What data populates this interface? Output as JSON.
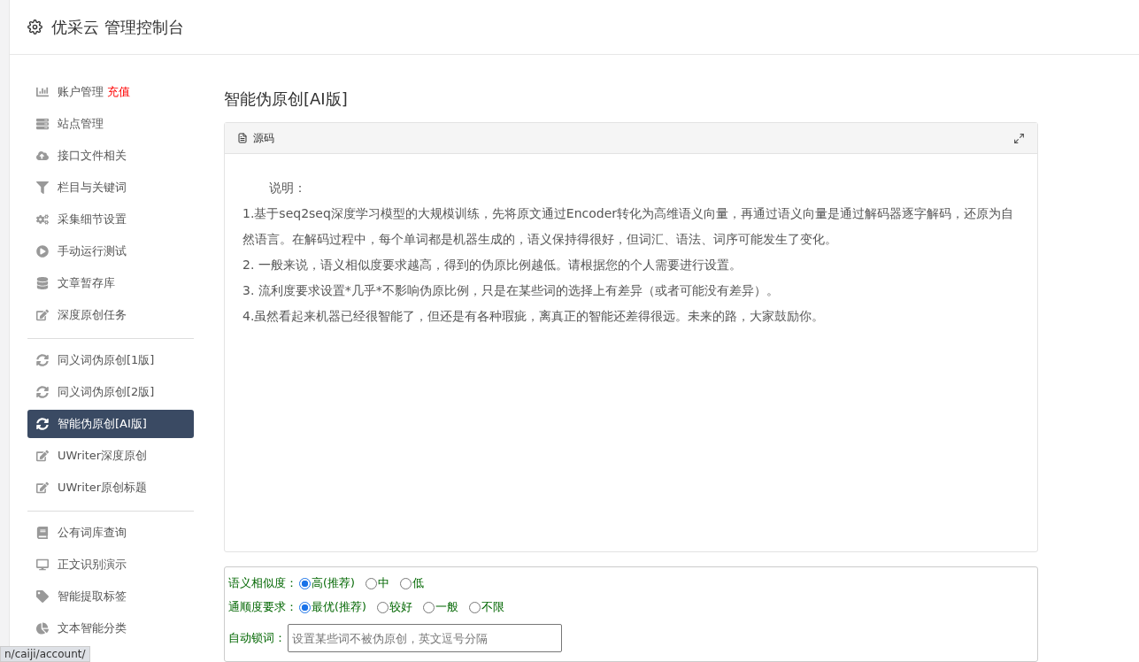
{
  "header": {
    "title": "优采云 管理控制台"
  },
  "sidebar": {
    "groups": [
      {
        "items": [
          {
            "label": "账户管理",
            "badge": "充值",
            "selected": false
          },
          {
            "label": "站点管理",
            "selected": false
          },
          {
            "label": "接口文件相关",
            "selected": false
          },
          {
            "label": "栏目与关键词",
            "selected": false
          },
          {
            "label": "采集细节设置",
            "selected": false
          },
          {
            "label": "手动运行测试",
            "selected": false
          },
          {
            "label": "文章暂存库",
            "selected": false
          },
          {
            "label": "深度原创任务",
            "selected": false
          }
        ]
      },
      {
        "items": [
          {
            "label": "同义词伪原创[1版]",
            "selected": false
          },
          {
            "label": "同义词伪原创[2版]",
            "selected": false
          },
          {
            "label": "智能伪原创[AI版]",
            "selected": true
          },
          {
            "label": "UWriter深度原创",
            "selected": false
          },
          {
            "label": "UWriter原创标题",
            "selected": false
          }
        ]
      },
      {
        "items": [
          {
            "label": "公有词库查询",
            "selected": false
          },
          {
            "label": "正文识别演示",
            "selected": false
          },
          {
            "label": "智能提取标签",
            "selected": false
          },
          {
            "label": "文本智能分类",
            "selected": false
          }
        ]
      }
    ]
  },
  "page_title": "智能伪原创[AI版]",
  "source_panel": {
    "tab": "源码",
    "lines": [
      "说明：",
      "1.基于seq2seq深度学习模型的大规模训练，先将原文通过Encoder转化为高维语义向量，再通过语义向量是通过解码器逐字解码，还原为自然语言。在解码过程中，每个单词都是机器生成的，语义保持得很好，但词汇、语法、词序可能发生了变化。",
      "2. 一般来说，语义相似度要求越高，得到的伪原比例越低。请根据您的个人需要进行设置。",
      "3. 流利度要求设置*几乎*不影响伪原比例，只是在某些词的选择上有差异（或者可能没有差异）。",
      "4.虽然看起来机器已经很智能了，但还是有各种瑕疵，离真正的智能还差得很远。未来的路，大家鼓励你。"
    ]
  },
  "form": {
    "similarity": {
      "label": "语义相似度：",
      "options": [
        {
          "label": "高(推荐)",
          "selected": true
        },
        {
          "label": "中",
          "selected": false
        },
        {
          "label": "低",
          "selected": false
        }
      ]
    },
    "fluency": {
      "label": "通顺度要求：",
      "options": [
        {
          "label": "最优(推荐)",
          "selected": true
        },
        {
          "label": "较好",
          "selected": false
        },
        {
          "label": "一般",
          "selected": false
        },
        {
          "label": "不限",
          "selected": false
        }
      ]
    },
    "lock_words": {
      "label": "自动锁词：",
      "placeholder": "设置某些词不被伪原创，英文逗号分隔"
    }
  },
  "status_url": "n/caiji/account/"
}
